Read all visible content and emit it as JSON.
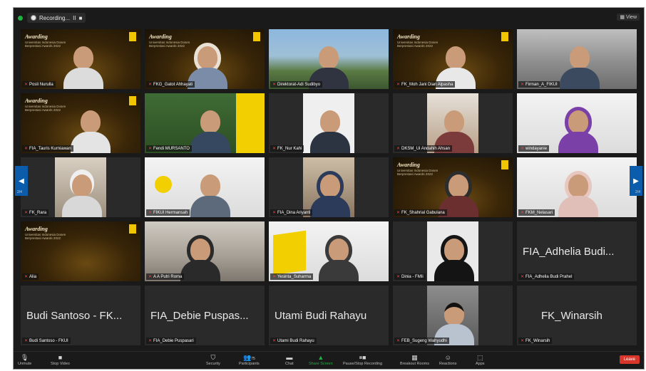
{
  "topbar": {
    "recording_label": "Recording...",
    "pause_symbol": "II",
    "stop_symbol": "■",
    "view_label": "View"
  },
  "navigation": {
    "left_arrow": "◀",
    "right_arrow": "▶",
    "left_page": "2/4",
    "right_page": "2/4"
  },
  "participants": [
    {
      "name": "Posli Nurulla",
      "big": ""
    },
    {
      "name": "FKG_Gatot Ahhayati",
      "big": ""
    },
    {
      "name": "Direktorat-Adi Sudibyo",
      "big": ""
    },
    {
      "name": "FK_Moh Jani Dian Alpasha",
      "big": ""
    },
    {
      "name": "Firman_A_FIKUI",
      "big": ""
    },
    {
      "name": "FIA_Tauris Kurniawan",
      "big": ""
    },
    {
      "name": "Fendi MURSANTO",
      "big": ""
    },
    {
      "name": "FK_Nur Kahi",
      "big": ""
    },
    {
      "name": "DKSM_Ui Andahih Ahsan",
      "big": ""
    },
    {
      "name": "windayanie",
      "big": ""
    },
    {
      "name": "FK_Rara",
      "big": ""
    },
    {
      "name": "FIKUI Hermansah",
      "big": ""
    },
    {
      "name": "FIA_Dina Ariyanti",
      "big": ""
    },
    {
      "name": "FK_Shahrial Gabulana",
      "big": ""
    },
    {
      "name": "FKM_Nelasari",
      "big": ""
    },
    {
      "name": "Alia",
      "big": ""
    },
    {
      "name": "A A Putri Roma",
      "big": ""
    },
    {
      "name": "Yesinta_Suharma",
      "big": ""
    },
    {
      "name": "Dinia - FMIi",
      "big": ""
    },
    {
      "name": "FIA_Adhelia Budi Prahel",
      "big": "FIA_Adhelia Budi..."
    },
    {
      "name": "Budi Santoso - FKUI",
      "big": "Budi Santoso  - FK..."
    },
    {
      "name": "FIA_Debie Puspasari",
      "big": "FIA_Debie Puspas..."
    },
    {
      "name": "Utami Budi Rahayu",
      "big": "Utami Budi Rahayu"
    },
    {
      "name": "FEB_Sugeng Wahyudhi",
      "big": ""
    },
    {
      "name": "FK_Winarsih",
      "big": "FK_Winarsih"
    }
  ],
  "award_banner": {
    "title": "Awarding",
    "subtitle": "Universitas Indonesia Dosen Berprestasi Awards 2022"
  },
  "toolbar": {
    "unmute": "Unmute",
    "stop_video": "Stop Video",
    "security": "Security",
    "participants": "Participants",
    "participants_count": "75",
    "chat": "Chat",
    "share_screen": "Share Screen",
    "pause_recording": "Pause/Stop Recording",
    "breakout_rooms": "Breakout Rooms",
    "reactions": "Reactions",
    "apps": "Apps",
    "leave": "Leave"
  }
}
